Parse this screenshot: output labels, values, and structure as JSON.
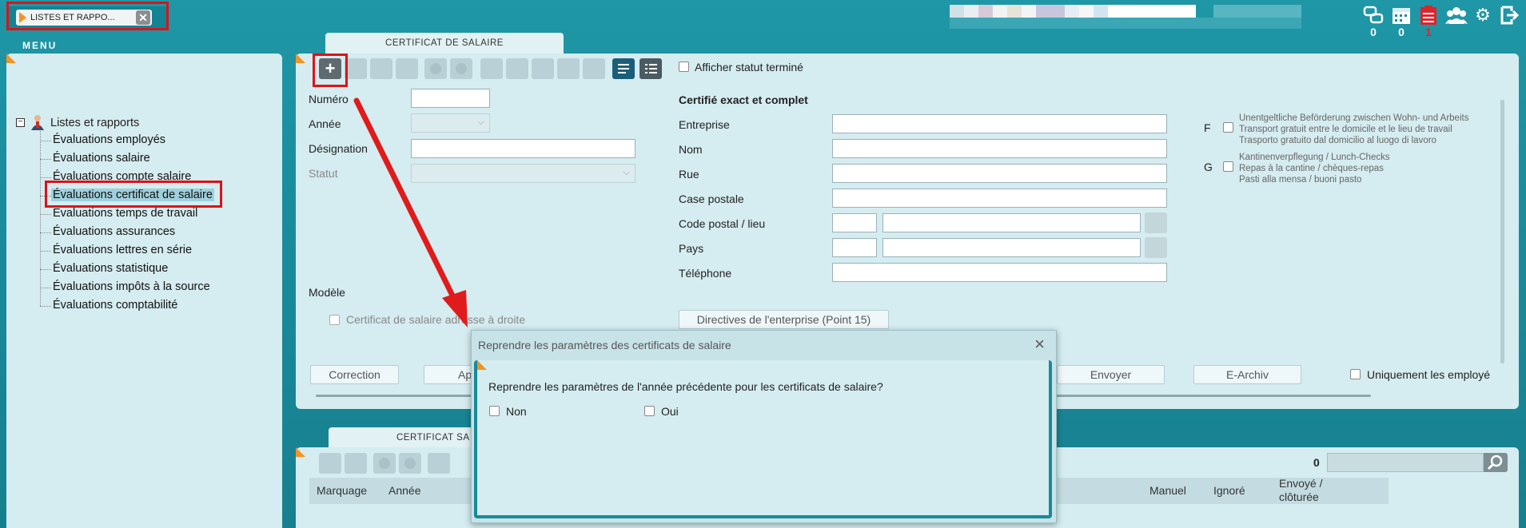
{
  "window": {
    "tab_label": "LISTES ET RAPPO..."
  },
  "top_counts": {
    "messages": "0",
    "calendar": "0",
    "tasks": "1"
  },
  "menu": {
    "title": "MENU"
  },
  "tree": {
    "root": "Listes et rapports",
    "items": [
      "Évaluations employés",
      "Évaluations salaire",
      "Évaluations compte salaire",
      "Évaluations certificat de salaire",
      "Évaluations temps de travail",
      "Évaluations assurances",
      "Évaluations lettres en série",
      "Évaluations statistique",
      "Évaluations impôts à la source",
      "Évaluations comptabilité"
    ]
  },
  "main": {
    "tab": "CERTIFICAT DE SALAIRE",
    "show_finished": "Afficher statut terminé",
    "numero": "Numéro",
    "annee": "Année",
    "designation": "Désignation",
    "statut": "Statut",
    "modele": "Modèle",
    "cert_right": "Certificat de salaire adresse à droite",
    "certified_title": "Certifié exact et complet",
    "entreprise": "Entreprise",
    "nom": "Nom",
    "rue": "Rue",
    "case_postale": "Case postale",
    "code_postal": "Code postal / lieu",
    "pays": "Pays",
    "telephone": "Téléphone",
    "directives": "Directives de l'enterprise (Point 15)",
    "f_letter": "F",
    "f_lines": [
      "Unentgeltliche Beförderung zwischen Wohn- und Arbeits",
      "Transport gratuit entre le domicile et le lieu de travail",
      "Trasporto gratuito dal domicilio al luogo di lavoro"
    ],
    "g_letter": "G",
    "g_lines": [
      "Kantinenverpflegung / Lunch-Checks",
      "Repas à la cantine / chèques-repas",
      "Pasti alla mensa / buoni pasto"
    ],
    "btn_correction": "Correction",
    "btn_ape": "Ape",
    "btn_envoyer": "Envoyer",
    "btn_earchiv": "E-Archiv",
    "only_employees": "Uniquement les employé"
  },
  "bottom": {
    "tab": "CERTIFICAT SA",
    "count": "0",
    "columns": [
      "Marquage",
      "Année",
      "Manuel",
      "Ignoré",
      "Envoyé /",
      "clôturée"
    ]
  },
  "dialog": {
    "title": "Reprendre les paramètres des certificats de salaire",
    "question": "Reprendre les paramètres de l'année précédente pour les certificats de salaire?",
    "no": "Non",
    "yes": "Oui"
  }
}
